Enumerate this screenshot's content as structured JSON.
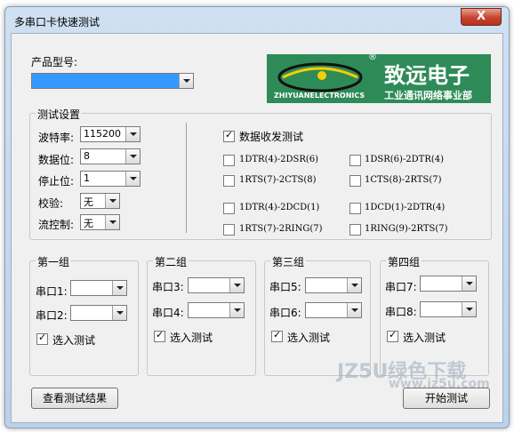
{
  "window": {
    "title": "多串口卡快速测试",
    "close_label": "X"
  },
  "product": {
    "label": "产品型号:",
    "selected": ""
  },
  "logo": {
    "cn_name": "致远电子",
    "en_name": "ZHIYUANELECTRONICS",
    "division": "工业通讯网络事业部",
    "registered": "®"
  },
  "settings": {
    "title": "测试设置",
    "rows": [
      {
        "label": "波特率:",
        "value": "115200"
      },
      {
        "label": "数据位:",
        "value": "8"
      },
      {
        "label": "停止位:",
        "value": "1"
      },
      {
        "label": "校验:",
        "value": "无"
      },
      {
        "label": "流控制:",
        "value": "无"
      }
    ],
    "data_test": {
      "label": "数据收发测试",
      "checked": true
    },
    "signals": [
      {
        "label": "1DTR(4)-2DSR(6)",
        "checked": false
      },
      {
        "label": "1DSR(6)-2DTR(4)",
        "checked": false
      },
      {
        "label": "1RTS(7)-2CTS(8)",
        "checked": false
      },
      {
        "label": "1CTS(8)-2RTS(7)",
        "checked": false
      },
      {
        "label": "1DTR(4)-2DCD(1)",
        "checked": false
      },
      {
        "label": "1DCD(1)-2DTR(4)",
        "checked": false
      },
      {
        "label": "1RTS(7)-2RING(7)",
        "checked": false
      },
      {
        "label": "1RING(9)-2RTS(7)",
        "checked": false
      }
    ]
  },
  "groups": [
    {
      "title": "第一组",
      "port_a": "串口1:",
      "port_b": "串口2:",
      "select_label": "选入测试",
      "checked": true
    },
    {
      "title": "第二组",
      "port_a": "串口3:",
      "port_b": "串口4:",
      "select_label": "选入测试",
      "checked": true
    },
    {
      "title": "第三组",
      "port_a": "串口5:",
      "port_b": "串口6:",
      "select_label": "选入测试",
      "checked": true
    },
    {
      "title": "第四组",
      "port_a": "串口7:",
      "port_b": "串口8:",
      "select_label": "选入测试",
      "checked": true
    }
  ],
  "buttons": {
    "view_results": "查看测试结果",
    "start_test": "开始测试"
  },
  "watermark": {
    "text1": "JZ5U绿色下载",
    "text2": "www.jz5u.com"
  },
  "colors": {
    "product_combo_selection": "#3399ff",
    "logo_bg": "#2e8b57"
  }
}
